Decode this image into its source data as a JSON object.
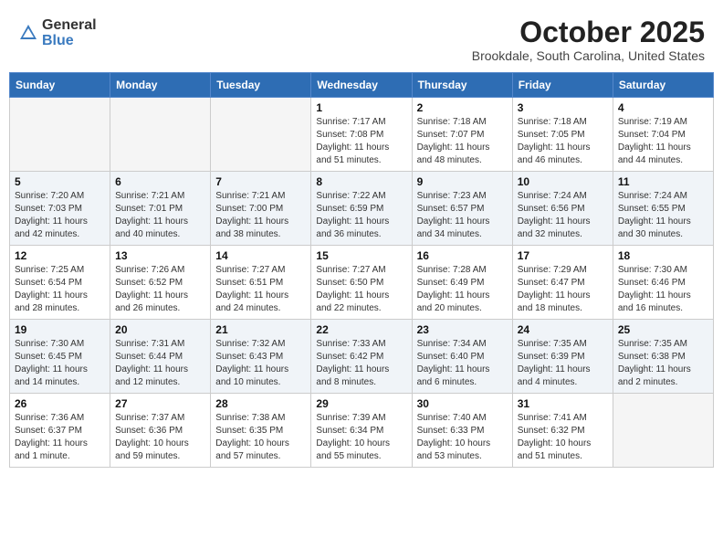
{
  "header": {
    "logo_general": "General",
    "logo_blue": "Blue",
    "month_title": "October 2025",
    "subtitle": "Brookdale, South Carolina, United States"
  },
  "weekdays": [
    "Sunday",
    "Monday",
    "Tuesday",
    "Wednesday",
    "Thursday",
    "Friday",
    "Saturday"
  ],
  "weeks": [
    [
      {
        "day": "",
        "info": ""
      },
      {
        "day": "",
        "info": ""
      },
      {
        "day": "",
        "info": ""
      },
      {
        "day": "1",
        "info": "Sunrise: 7:17 AM\nSunset: 7:08 PM\nDaylight: 11 hours\nand 51 minutes."
      },
      {
        "day": "2",
        "info": "Sunrise: 7:18 AM\nSunset: 7:07 PM\nDaylight: 11 hours\nand 48 minutes."
      },
      {
        "day": "3",
        "info": "Sunrise: 7:18 AM\nSunset: 7:05 PM\nDaylight: 11 hours\nand 46 minutes."
      },
      {
        "day": "4",
        "info": "Sunrise: 7:19 AM\nSunset: 7:04 PM\nDaylight: 11 hours\nand 44 minutes."
      }
    ],
    [
      {
        "day": "5",
        "info": "Sunrise: 7:20 AM\nSunset: 7:03 PM\nDaylight: 11 hours\nand 42 minutes."
      },
      {
        "day": "6",
        "info": "Sunrise: 7:21 AM\nSunset: 7:01 PM\nDaylight: 11 hours\nand 40 minutes."
      },
      {
        "day": "7",
        "info": "Sunrise: 7:21 AM\nSunset: 7:00 PM\nDaylight: 11 hours\nand 38 minutes."
      },
      {
        "day": "8",
        "info": "Sunrise: 7:22 AM\nSunset: 6:59 PM\nDaylight: 11 hours\nand 36 minutes."
      },
      {
        "day": "9",
        "info": "Sunrise: 7:23 AM\nSunset: 6:57 PM\nDaylight: 11 hours\nand 34 minutes."
      },
      {
        "day": "10",
        "info": "Sunrise: 7:24 AM\nSunset: 6:56 PM\nDaylight: 11 hours\nand 32 minutes."
      },
      {
        "day": "11",
        "info": "Sunrise: 7:24 AM\nSunset: 6:55 PM\nDaylight: 11 hours\nand 30 minutes."
      }
    ],
    [
      {
        "day": "12",
        "info": "Sunrise: 7:25 AM\nSunset: 6:54 PM\nDaylight: 11 hours\nand 28 minutes."
      },
      {
        "day": "13",
        "info": "Sunrise: 7:26 AM\nSunset: 6:52 PM\nDaylight: 11 hours\nand 26 minutes."
      },
      {
        "day": "14",
        "info": "Sunrise: 7:27 AM\nSunset: 6:51 PM\nDaylight: 11 hours\nand 24 minutes."
      },
      {
        "day": "15",
        "info": "Sunrise: 7:27 AM\nSunset: 6:50 PM\nDaylight: 11 hours\nand 22 minutes."
      },
      {
        "day": "16",
        "info": "Sunrise: 7:28 AM\nSunset: 6:49 PM\nDaylight: 11 hours\nand 20 minutes."
      },
      {
        "day": "17",
        "info": "Sunrise: 7:29 AM\nSunset: 6:47 PM\nDaylight: 11 hours\nand 18 minutes."
      },
      {
        "day": "18",
        "info": "Sunrise: 7:30 AM\nSunset: 6:46 PM\nDaylight: 11 hours\nand 16 minutes."
      }
    ],
    [
      {
        "day": "19",
        "info": "Sunrise: 7:30 AM\nSunset: 6:45 PM\nDaylight: 11 hours\nand 14 minutes."
      },
      {
        "day": "20",
        "info": "Sunrise: 7:31 AM\nSunset: 6:44 PM\nDaylight: 11 hours\nand 12 minutes."
      },
      {
        "day": "21",
        "info": "Sunrise: 7:32 AM\nSunset: 6:43 PM\nDaylight: 11 hours\nand 10 minutes."
      },
      {
        "day": "22",
        "info": "Sunrise: 7:33 AM\nSunset: 6:42 PM\nDaylight: 11 hours\nand 8 minutes."
      },
      {
        "day": "23",
        "info": "Sunrise: 7:34 AM\nSunset: 6:40 PM\nDaylight: 11 hours\nand 6 minutes."
      },
      {
        "day": "24",
        "info": "Sunrise: 7:35 AM\nSunset: 6:39 PM\nDaylight: 11 hours\nand 4 minutes."
      },
      {
        "day": "25",
        "info": "Sunrise: 7:35 AM\nSunset: 6:38 PM\nDaylight: 11 hours\nand 2 minutes."
      }
    ],
    [
      {
        "day": "26",
        "info": "Sunrise: 7:36 AM\nSunset: 6:37 PM\nDaylight: 11 hours\nand 1 minute."
      },
      {
        "day": "27",
        "info": "Sunrise: 7:37 AM\nSunset: 6:36 PM\nDaylight: 10 hours\nand 59 minutes."
      },
      {
        "day": "28",
        "info": "Sunrise: 7:38 AM\nSunset: 6:35 PM\nDaylight: 10 hours\nand 57 minutes."
      },
      {
        "day": "29",
        "info": "Sunrise: 7:39 AM\nSunset: 6:34 PM\nDaylight: 10 hours\nand 55 minutes."
      },
      {
        "day": "30",
        "info": "Sunrise: 7:40 AM\nSunset: 6:33 PM\nDaylight: 10 hours\nand 53 minutes."
      },
      {
        "day": "31",
        "info": "Sunrise: 7:41 AM\nSunset: 6:32 PM\nDaylight: 10 hours\nand 51 minutes."
      },
      {
        "day": "",
        "info": ""
      }
    ]
  ]
}
